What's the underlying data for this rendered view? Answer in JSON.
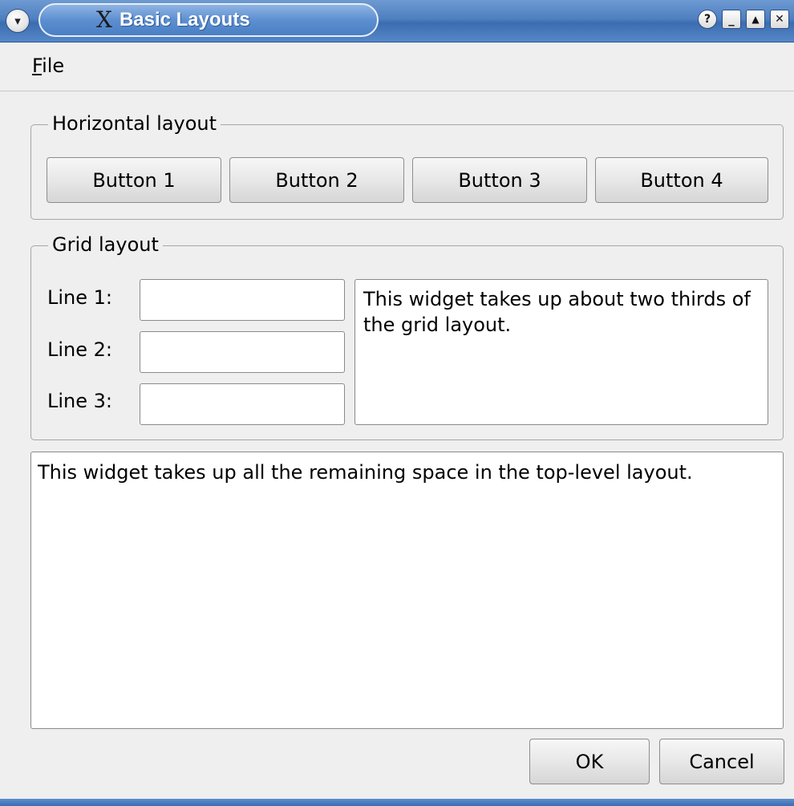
{
  "window": {
    "title": "Basic Layouts",
    "app_icon": "x-logo-icon",
    "menu_icon": "chevron-down-icon",
    "controls": {
      "help": "?",
      "minimize": "_",
      "maximize": "▲",
      "close": "✕"
    }
  },
  "menubar": {
    "file_mnemonic": "F",
    "file_rest": "ile"
  },
  "horizontal_group": {
    "title": "Horizontal layout",
    "buttons": [
      "Button 1",
      "Button 2",
      "Button 3",
      "Button 4"
    ]
  },
  "grid_group": {
    "title": "Grid layout",
    "labels": [
      "Line 1:",
      "Line 2:",
      "Line 3:"
    ],
    "values": [
      "",
      "",
      ""
    ],
    "text": "This widget takes up about two thirds of the grid layout."
  },
  "main_text": "This widget takes up all the remaining space in the top-level layout.",
  "dialog_buttons": {
    "ok": "OK",
    "cancel": "Cancel"
  },
  "colors": {
    "titlebar": "#4f7fc0",
    "window_bg": "#efefef",
    "title_text": "#ffffff"
  }
}
